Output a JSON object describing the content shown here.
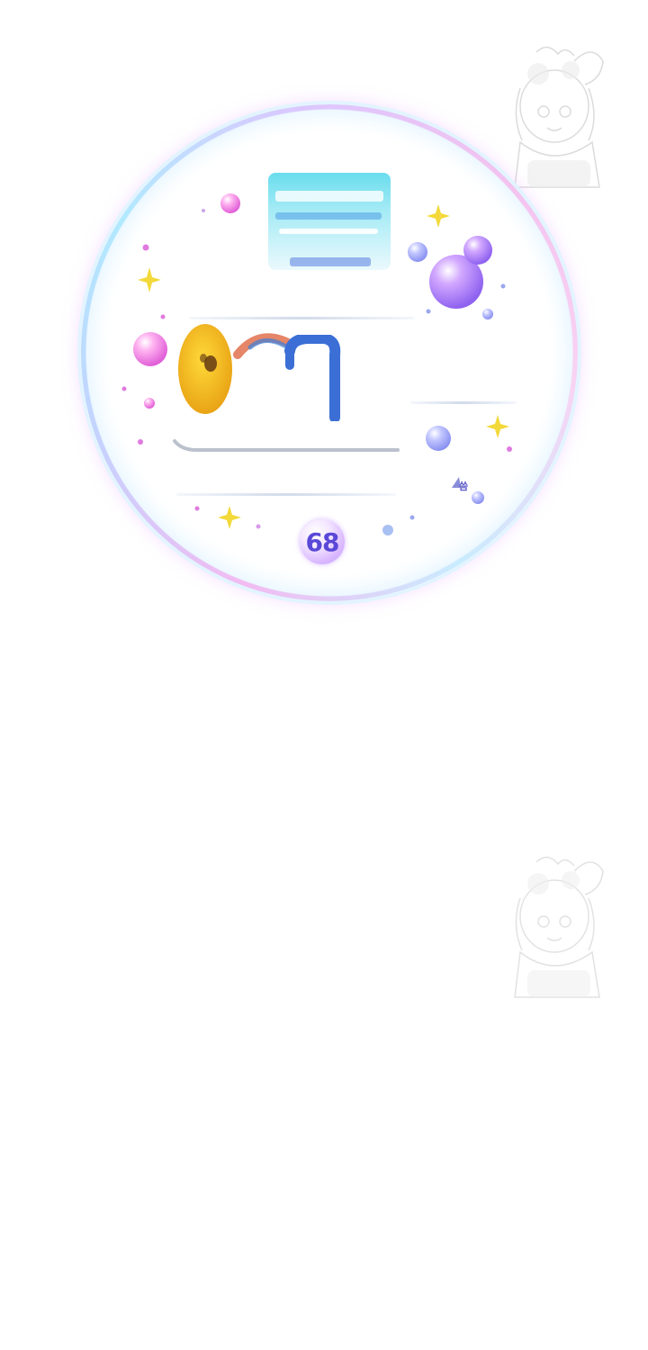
{
  "badge": {
    "value": "68"
  },
  "watermark": {
    "icon": "anime-character-watermark"
  },
  "small_glyph": {
    "text": "씀"
  },
  "colors": {
    "bubble_pink": "#f6a8ee",
    "bubble_blue": "#9fe6ff",
    "badge_text": "#5a48d8",
    "face_yellow": "#f5c118",
    "bracket_blue": "#3b6fd6",
    "arc_red": "#e0714e",
    "sparkle_yellow": "#f3d93a",
    "ice_cyan": "#3fd0e6"
  }
}
